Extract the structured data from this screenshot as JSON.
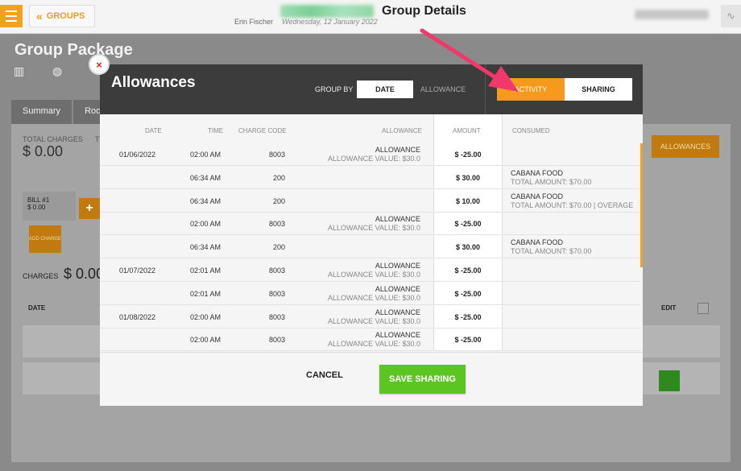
{
  "app": {
    "groups_label": "GROUPS",
    "page_title": "Group Details",
    "user_name": "Erin Fischer",
    "date": "Wednesday, 12 January 2022"
  },
  "background": {
    "group_title": "Group Package",
    "tabs": [
      "Summary",
      "Roo"
    ],
    "total_charges_label": "TOTAL CHARGES",
    "total_charges_value": "$ 0.00",
    "total_label_2": "T",
    "allowances_button": "ALLOWANCES",
    "bill_label": "BILL #1",
    "bill_value": "$ 0.00",
    "add_symbol": "+",
    "add_charge_label": "ADD CHARGE",
    "charges_label": "CHARGES",
    "charges_value": "$ 0.00",
    "date_header": "DATE",
    "edit_header": "EDIT"
  },
  "modal": {
    "title": "Allowances",
    "group_by_label": "GROUP BY",
    "group_by_options": [
      "DATE",
      "ALLOWANCE"
    ],
    "view_options": [
      "ACTIVITY",
      "SHARING"
    ],
    "columns": {
      "date": "DATE",
      "time": "TIME",
      "code": "CHARGE CODE",
      "allowance": "ALLOWANCE",
      "amount": "AMOUNT",
      "consumed": "CONSUMED"
    },
    "rows": [
      {
        "date": "01/06/2022",
        "time": "02:00 AM",
        "code": "8003",
        "allowance": "ALLOWANCE",
        "allowance_sub": "ALLOWANCE VALUE: $30.0",
        "amount": "$ -25.00",
        "consumed": "",
        "consumed_sub": ""
      },
      {
        "date": "",
        "time": "06:34 AM",
        "code": "200",
        "allowance": "",
        "allowance_sub": "",
        "amount": "$ 30.00",
        "consumed": "CABANA FOOD",
        "consumed_sub": "TOTAL AMOUNT: $70.00"
      },
      {
        "date": "",
        "time": "06:34 AM",
        "code": "200",
        "allowance": "",
        "allowance_sub": "",
        "amount": "$ 10.00",
        "consumed": "CABANA FOOD",
        "consumed_sub": "TOTAL AMOUNT: $70.00 | OVERAGE"
      },
      {
        "date": "",
        "time": "02:00 AM",
        "code": "8003",
        "allowance": "ALLOWANCE",
        "allowance_sub": "ALLOWANCE VALUE: $30.0",
        "amount": "$ -25.00",
        "consumed": "",
        "consumed_sub": ""
      },
      {
        "date": "",
        "time": "06:34 AM",
        "code": "200",
        "allowance": "",
        "allowance_sub": "",
        "amount": "$ 30.00",
        "consumed": "CABANA FOOD",
        "consumed_sub": "TOTAL AMOUNT: $70.00"
      },
      {
        "date": "01/07/2022",
        "time": "02:01 AM",
        "code": "8003",
        "allowance": "ALLOWANCE",
        "allowance_sub": "ALLOWANCE VALUE: $30.0",
        "amount": "$ -25.00",
        "consumed": "",
        "consumed_sub": ""
      },
      {
        "date": "",
        "time": "02:01 AM",
        "code": "8003",
        "allowance": "ALLOWANCE",
        "allowance_sub": "ALLOWANCE VALUE: $30.0",
        "amount": "$ -25.00",
        "consumed": "",
        "consumed_sub": ""
      },
      {
        "date": "01/08/2022",
        "time": "02:00 AM",
        "code": "8003",
        "allowance": "ALLOWANCE",
        "allowance_sub": "ALLOWANCE VALUE: $30.0",
        "amount": "$ -25.00",
        "consumed": "",
        "consumed_sub": ""
      },
      {
        "date": "",
        "time": "02:00 AM",
        "code": "8003",
        "allowance": "ALLOWANCE",
        "allowance_sub": "ALLOWANCE VALUE: $30.0",
        "amount": "$ -25.00",
        "consumed": "",
        "consumed_sub": ""
      }
    ],
    "cancel_label": "CANCEL",
    "save_label": "SAVE SHARING"
  },
  "icons": {
    "close": "×",
    "back_chevron": "«",
    "pulse": "∿"
  },
  "colors": {
    "accent": "#f59a1c",
    "save_green": "#5cc522",
    "annotation_arrow": "#f0386b"
  }
}
